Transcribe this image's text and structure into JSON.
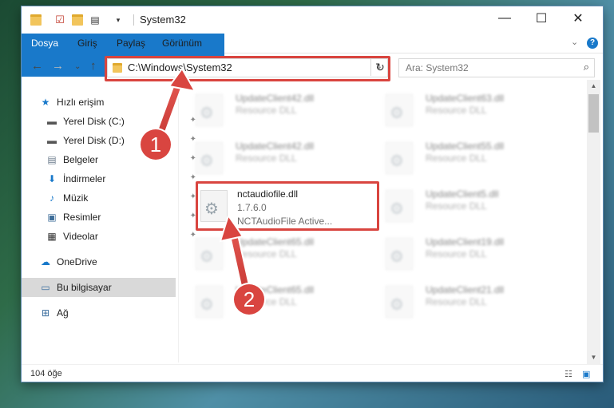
{
  "window": {
    "title": "System32"
  },
  "ribbon": {
    "tabs": [
      "Dosya",
      "Giriş",
      "Paylaş",
      "Görünüm"
    ]
  },
  "address": {
    "path": "C:\\Windows\\System32",
    "search_placeholder": "Ara: System32"
  },
  "nav": {
    "items": [
      {
        "label": "Hızlı erişim",
        "icon": "star-icon",
        "pinned": false
      },
      {
        "label": "Yerel Disk (C:)",
        "icon": "drive-icon",
        "pinned": true
      },
      {
        "label": "Yerel Disk (D:)",
        "icon": "drive-icon",
        "pinned": true
      },
      {
        "label": "Belgeler",
        "icon": "document-icon",
        "pinned": true
      },
      {
        "label": "İndirmeler",
        "icon": "download-icon",
        "pinned": true
      },
      {
        "label": "Müzik",
        "icon": "music-icon",
        "pinned": true
      },
      {
        "label": "Resimler",
        "icon": "picture-icon",
        "pinned": true
      },
      {
        "label": "Videolar",
        "icon": "video-icon",
        "pinned": true
      },
      {
        "label": "OneDrive",
        "icon": "cloud-icon",
        "pinned": false
      },
      {
        "label": "Bu bilgisayar",
        "icon": "computer-icon",
        "pinned": false
      },
      {
        "label": "Ağ",
        "icon": "network-icon",
        "pinned": false
      }
    ]
  },
  "files": {
    "col1": [
      {
        "name": "UpdateClient42.dll",
        "desc": "Resource DLL"
      },
      {
        "name": "UpdateClient42.dll",
        "desc": "Resource DLL"
      },
      {
        "name": "nctaudiofile.dll",
        "version": "1.7.6.0",
        "desc": "NCTAudioFile Active..."
      },
      {
        "name": "UpdateClient65.dll",
        "desc": "Resource DLL"
      },
      {
        "name": "UpdateClient65.dll",
        "desc": "Resource DLL"
      }
    ],
    "col2": [
      {
        "name": "UpdateClient63.dll",
        "desc": "Resource DLL"
      },
      {
        "name": "UpdateClient55.dll",
        "desc": "Resource DLL"
      },
      {
        "name": "UpdateClient5.dll",
        "desc": "Resource DLL"
      },
      {
        "name": "UpdateClient19.dll",
        "desc": "Resource DLL"
      },
      {
        "name": "UpdateClient21.dll",
        "desc": "Resource DLL"
      }
    ]
  },
  "status": {
    "count": "104 öğe"
  },
  "annotations": {
    "step1": "1",
    "step2": "2"
  },
  "colors": {
    "accent": "#1979ca",
    "highlight": "#d9453f"
  }
}
